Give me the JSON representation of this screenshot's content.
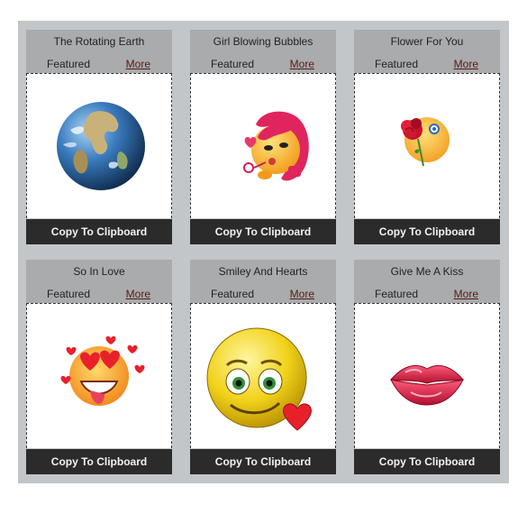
{
  "gallery": {
    "cards": [
      {
        "title": "The Rotating Earth",
        "featured": "Featured",
        "more": "More",
        "copy": "Copy To Clipboard",
        "image": "earth-globe-icon"
      },
      {
        "title": "Girl Blowing Bubbles",
        "featured": "Featured",
        "more": "More",
        "copy": "Copy To Clipboard",
        "image": "girl-blowing-bubbles-icon"
      },
      {
        "title": "Flower For You",
        "featured": "Featured",
        "more": "More",
        "copy": "Copy To Clipboard",
        "image": "smiley-with-rose-icon"
      },
      {
        "title": "So In Love",
        "featured": "Featured",
        "more": "More",
        "copy": "Copy To Clipboard",
        "image": "smiley-heart-eyes-icon"
      },
      {
        "title": "Smiley And Hearts",
        "featured": "Featured",
        "more": "More",
        "copy": "Copy To Clipboard",
        "image": "smiley-and-heart-icon"
      },
      {
        "title": "Give Me A Kiss",
        "featured": "Featured",
        "more": "More",
        "copy": "Copy To Clipboard",
        "image": "kiss-lips-icon"
      }
    ]
  },
  "colors": {
    "panel": "#c3c6c8",
    "card_header": "#a9abad",
    "copy_bar": "#2b2b2b",
    "more_link": "#5a1a12"
  }
}
